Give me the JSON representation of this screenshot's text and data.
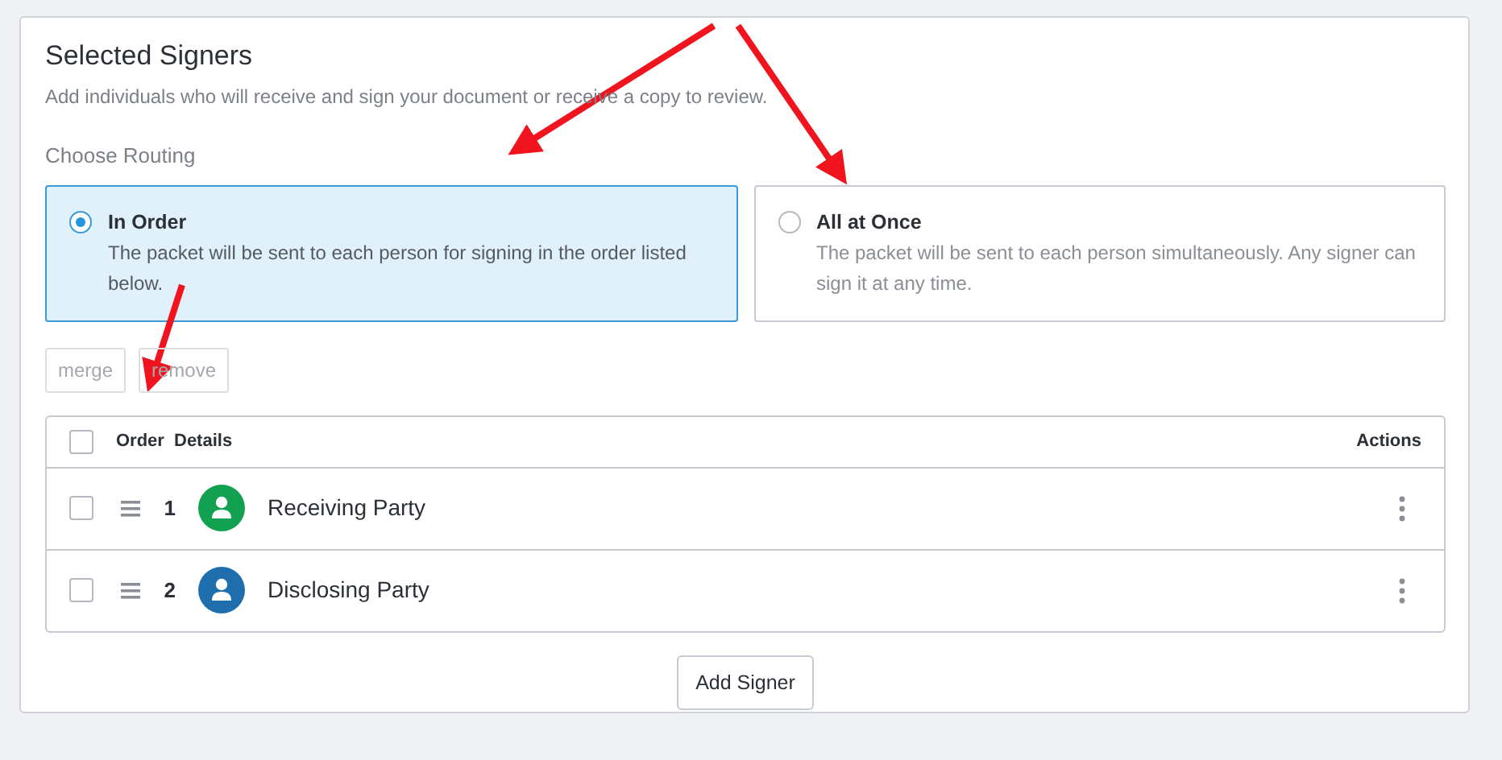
{
  "panel": {
    "title": "Selected Signers",
    "subtitle": "Add individuals who will receive and sign your document or receive a copy to review."
  },
  "routing": {
    "label": "Choose Routing",
    "options": [
      {
        "title": "In Order",
        "description": "The packet will be sent to each person for signing in the order listed below.",
        "selected": true
      },
      {
        "title": "All at Once",
        "description": "The packet will be sent to each person simultaneously. Any signer can sign it at any time.",
        "selected": false
      }
    ]
  },
  "bulk_buttons": [
    {
      "label": "merge",
      "disabled": true
    },
    {
      "label": "remove",
      "disabled": true
    }
  ],
  "table": {
    "select_all_checked": false,
    "columns": [
      "Order",
      "Details",
      "Actions"
    ],
    "rows": [
      {
        "checked": false,
        "order": "1",
        "name": "Receiving Party",
        "color": "#12a150"
      },
      {
        "checked": false,
        "order": "2",
        "name": "Disclosing Party",
        "color": "#1f6fae"
      }
    ]
  },
  "add_button": "Add Signer"
}
